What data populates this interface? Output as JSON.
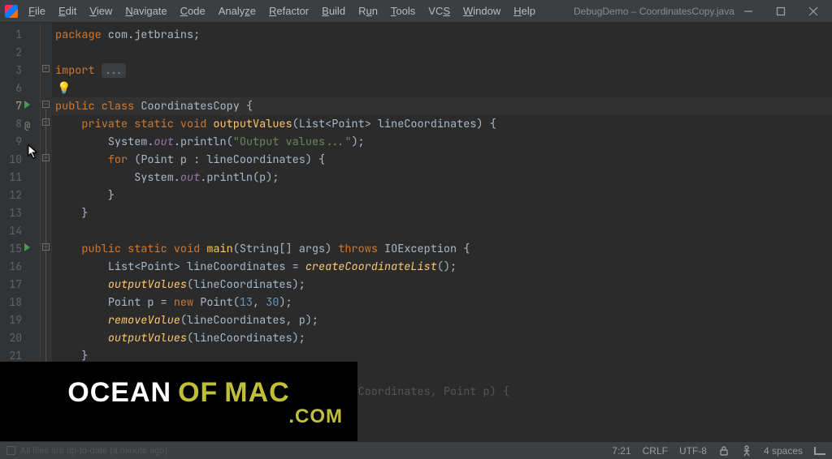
{
  "menu": {
    "file": "File",
    "edit": "Edit",
    "view": "View",
    "navigate": "Navigate",
    "code": "Code",
    "analyze": "Analyze",
    "refactor": "Refactor",
    "build": "Build",
    "run": "Run",
    "tools": "Tools",
    "vcs": "VCS",
    "window": "Window",
    "help": "Help"
  },
  "title": "DebugDemo – CoordinatesCopy.java – IntelliJ IDEA",
  "gutter": {
    "lines": [
      "1",
      "2",
      "3",
      "6",
      "7",
      "8",
      "9",
      "10",
      "11",
      "12",
      "13",
      "14",
      "15",
      "16",
      "17",
      "18",
      "19",
      "20",
      "21",
      "",
      "",
      ""
    ]
  },
  "code": {
    "l1_kw1": "package",
    "l1_pkg": " com.jetbrains",
    "l1_semi": ";",
    "l3_kw": "import",
    "l3_dots": "...",
    "l7_kw1": "public ",
    "l7_kw2": "class ",
    "l7_name": "CoordinatesCopy",
    "l7_brace": " {",
    "l8_kw1": "private ",
    "l8_kw2": "static ",
    "l8_kw3": "void ",
    "l8_fn": "outputValues",
    "l8_sig": "(List<Point> lineCoordinates) {",
    "l9_sys": "System.",
    "l9_out": "out",
    "l9_dot": ".",
    "l9_pr": "println",
    "l9_open": "(",
    "l9_str": "\"Output values...\"",
    "l9_close": ");",
    "l10_kw": "for ",
    "l10_rest": "(Point p : lineCoordinates) {",
    "l11_sys": "System.",
    "l11_out": "out",
    "l11_dot": ".",
    "l11_pr": "println",
    "l11_rest": "(p);",
    "l12": "}",
    "l13": "}",
    "l15_kw1": "public ",
    "l15_kw2": "static ",
    "l15_kw3": "void ",
    "l15_fn": "main",
    "l15_sig1": "(String[] args) ",
    "l15_kw4": "throws ",
    "l15_exc": "IOException",
    "l15_brace": " {",
    "l16_a": "List<Point> lineCoordinates = ",
    "l16_fn": "createCoordinateList",
    "l16_b": "();",
    "l17_fn": "outputValues",
    "l17_rest": "(lineCoordinates);",
    "l18_a": "Point p = ",
    "l18_kw": "new ",
    "l18_b": "Point(",
    "l18_n1": "13",
    "l18_c": ", ",
    "l18_n2": "30",
    "l18_d": ");",
    "l19_fn": "removeValue",
    "l19_rest": "(lineCoordinates, p);",
    "l20_fn": "outputValues",
    "l20_rest": "(lineCoordinates);",
    "l21": "}",
    "l23_dim": "                             (List<Point> lineCoordinates, Point p) {"
  },
  "status": {
    "vcs": "All files are up-to-date (a minute ago)",
    "pos": "7:21",
    "eol": "CRLF",
    "enc": "UTF-8",
    "indent": "4 spaces"
  },
  "watermark": {
    "w1": "OCEAN",
    "w2": "OF",
    "w3": "MAC",
    "w4": ".COM"
  }
}
